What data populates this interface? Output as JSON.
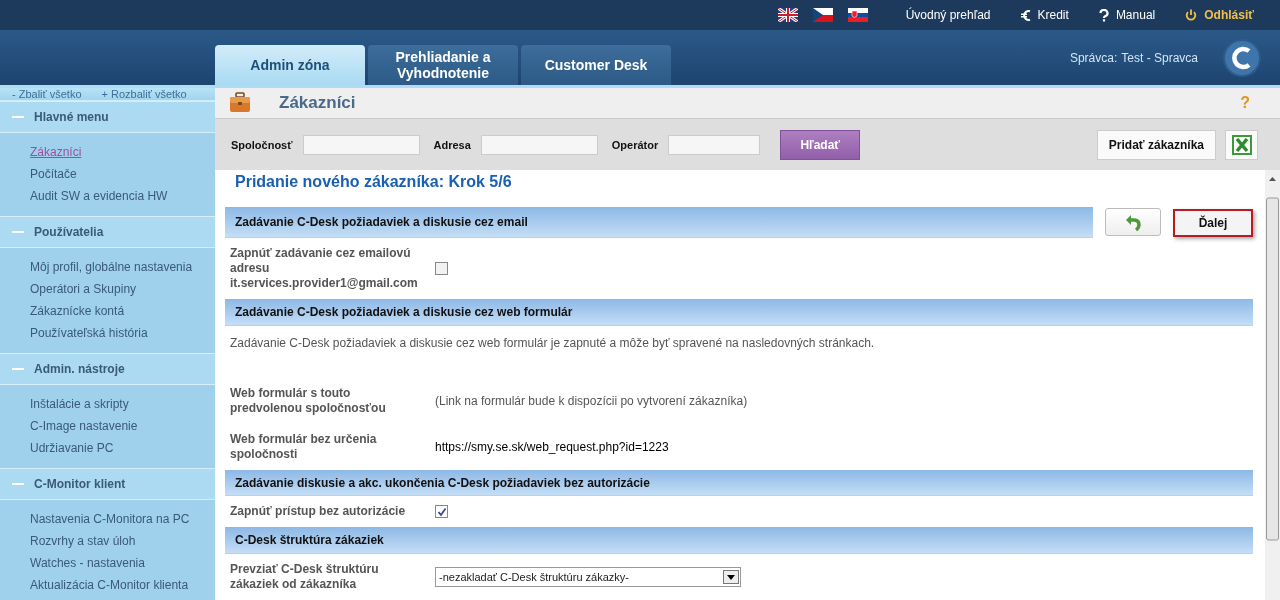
{
  "top_bar": {
    "links": [
      {
        "kind": "plain",
        "label": "Úvodný prehľad"
      },
      {
        "kind": "euro",
        "label": "Kredit"
      },
      {
        "kind": "help",
        "label": "Manual"
      },
      {
        "kind": "logout",
        "label": "Odhlásiť"
      }
    ]
  },
  "tabs": [
    {
      "label": "Admin zóna",
      "selected": true
    },
    {
      "label": "Prehliadanie a Vyhodnotenie",
      "selected": false
    },
    {
      "label": "Customer Desk",
      "selected": false
    }
  ],
  "user": {
    "label": "Správca:",
    "name": "Test - Spravca"
  },
  "sidebar": {
    "collapse_all": "- Zbaliť všetko",
    "expand_all": "+ Rozbaliť všetko",
    "groups": [
      {
        "title": "Hlavné menu",
        "expanded": true,
        "items": [
          {
            "label": "Zákazníci",
            "selected": true
          },
          {
            "label": "Počítače",
            "selected": false
          },
          {
            "label": "Audit SW a evidencia HW",
            "selected": false
          }
        ]
      },
      {
        "title": "Používatelia",
        "expanded": true,
        "items": [
          {
            "label": "Môj profil, globálne nastavenia",
            "selected": false
          },
          {
            "label": "Operátori a Skupiny",
            "selected": false
          },
          {
            "label": "Zákaznícke kontá",
            "selected": false
          },
          {
            "label": "Používateľská história",
            "selected": false
          }
        ]
      },
      {
        "title": "Admin. nástroje",
        "expanded": true,
        "items": [
          {
            "label": "Inštalácie a skripty",
            "selected": false
          },
          {
            "label": "C-Image nastavenie",
            "selected": false
          },
          {
            "label": "Udržiavanie PC",
            "selected": false
          }
        ]
      },
      {
        "title": "C-Monitor klient",
        "expanded": true,
        "items": [
          {
            "label": "Nastavenia C-Monitora na PC",
            "selected": false
          },
          {
            "label": "Rozvrhy a stav úloh",
            "selected": false
          },
          {
            "label": "Watches - nastavenia",
            "selected": false
          },
          {
            "label": "Aktualizácia C-Monitor klienta",
            "selected": false
          }
        ]
      }
    ]
  },
  "page": {
    "title": "Zákazníci",
    "help": "?"
  },
  "filters": [
    {
      "label": "Spoločnosť"
    },
    {
      "label": "Adresa"
    },
    {
      "label": "Operátor"
    }
  ],
  "search_button": "Hľadať",
  "add_button": "Pridať zákazníka",
  "form": {
    "heading": "Pridanie nového zákazníka: Krok 5/6",
    "next_button": "Ďalej",
    "blocks": [
      {
        "kind": "section",
        "title": "Zadávanie C-Desk požiadaviek a diskusie cez email"
      },
      {
        "kind": "checkbox",
        "label": "Zapnúť zadávanie cez emailovú adresu it.services.provider1@gmail.com",
        "checked": false
      },
      {
        "kind": "section",
        "title": "Zadávanie C-Desk požiadaviek a diskusie cez web formulár"
      },
      {
        "kind": "note",
        "text": "Zadávanie C-Desk požiadaviek a diskusie cez web formulár je zapnuté a môže byť spravené na nasledovných stránkach."
      },
      {
        "kind": "field",
        "label": "Web formulár s touto predvolenou spoločnosťou",
        "value": "(Link na formulár bude k dispozícii po vytvorení zákazníka)",
        "muted": true
      },
      {
        "kind": "field",
        "label": "Web formulár bez určenia spoločnosti",
        "value": "https://smy.se.sk/web_request.php?id=1223",
        "muted": false
      },
      {
        "kind": "section",
        "title": "Zadávanie diskusie a akc. ukončenia C-Desk požiadaviek bez autorizácie"
      },
      {
        "kind": "checkbox",
        "label": "Zapnúť prístup bez autorizácie",
        "checked": true
      },
      {
        "kind": "section",
        "title": "C-Desk štruktúra zákaziek"
      },
      {
        "kind": "select",
        "label": "Prevziať C-Desk štruktúru zákaziek od zákazníka",
        "value": "-nezakladať C-Desk štruktúru zákazky-"
      }
    ]
  }
}
